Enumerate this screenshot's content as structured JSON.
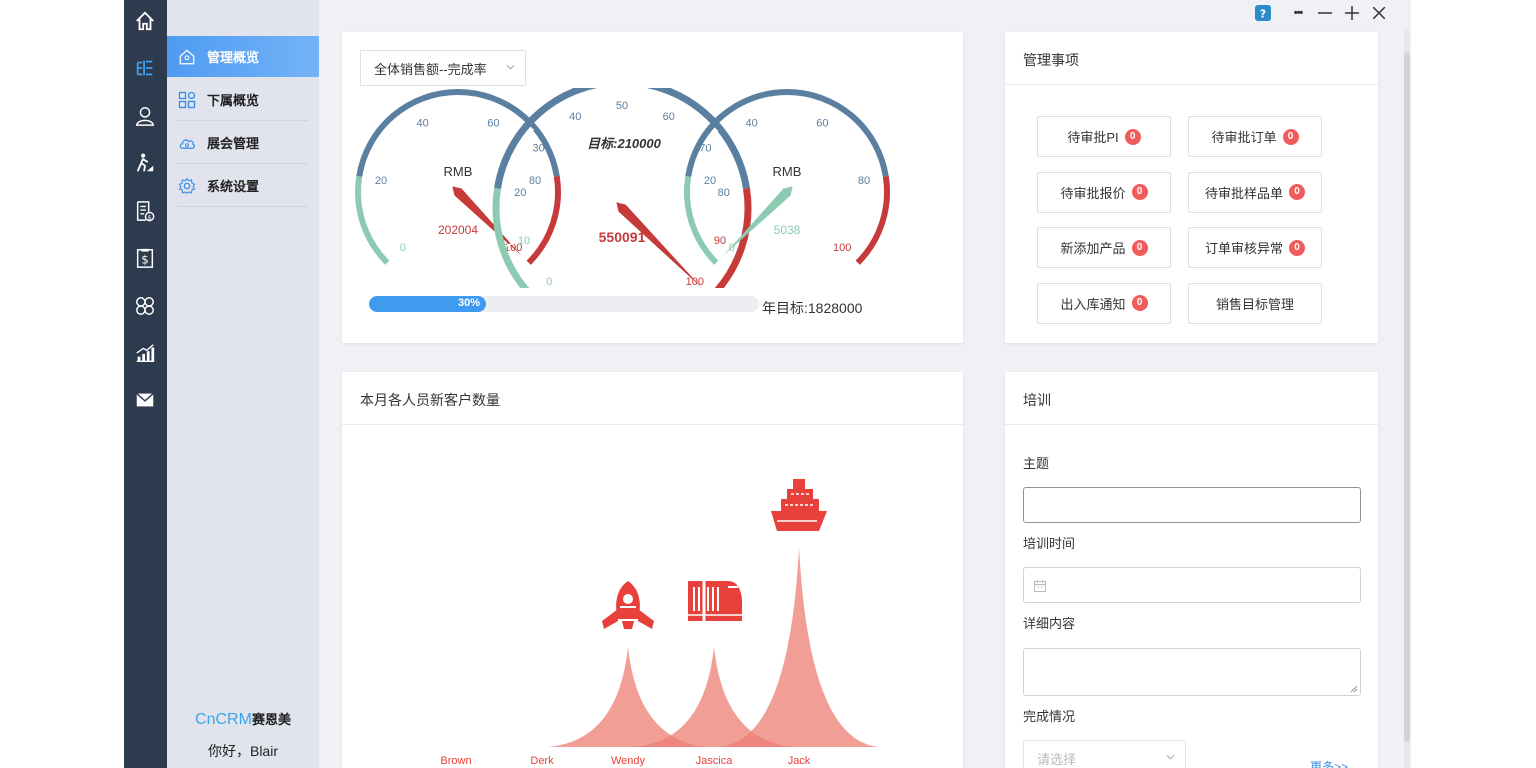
{
  "colors": {
    "rail_bg": "#2e3a4d",
    "nav_bg": "#e1e4ec",
    "nav_active": "#4f9bf2",
    "gauge_blue": "#5a7fa0",
    "gauge_green": "#8ccbb1",
    "gauge_red": "#c63a3a",
    "progress": "#3e9bf0",
    "chart_fill": "#ec7d74",
    "chart_icon": "#e8403a",
    "badge": "#f05c5c"
  },
  "rail": {
    "icons": [
      "home-icon",
      "org-chart-icon",
      "customer-icon",
      "visit-icon",
      "invoice-icon",
      "finance-icon",
      "apps-icon",
      "stats-icon",
      "mail-icon"
    ]
  },
  "nav": {
    "items": [
      {
        "label": "管理概览",
        "icon": "home-outline-icon"
      },
      {
        "label": "下属概览",
        "icon": "grid-icon"
      },
      {
        "label": "展会管理",
        "icon": "cloud-icon"
      },
      {
        "label": "系统设置",
        "icon": "gear-icon"
      }
    ],
    "brand_name": "CnCRM",
    "brand_cn": "赛恩美",
    "greeting": "你好，Blair"
  },
  "window": {
    "help": "?",
    "more": "•••"
  },
  "sales": {
    "select_value": "全体销售额--完成率",
    "gauges": [
      {
        "name": "left",
        "unit": "RMB",
        "value_text": "202004",
        "min": 0,
        "max": 100,
        "pointer": 100,
        "ticks": [
          "0",
          "20",
          "40",
          "60",
          "80",
          "100"
        ]
      },
      {
        "name": "center",
        "title": "目标:210000",
        "value_text": "550091",
        "min": 0,
        "max": 100,
        "pointer": 100,
        "ticks": [
          "0",
          "10",
          "20",
          "30",
          "40",
          "50",
          "60",
          "70",
          "80",
          "90",
          "100"
        ]
      },
      {
        "name": "right",
        "unit": "RMB",
        "value_text": "5038",
        "min": 0,
        "max": 100,
        "pointer": 0,
        "ticks": [
          "0",
          "20",
          "40",
          "60",
          "80",
          "100"
        ]
      }
    ],
    "progress_percent": 30,
    "progress_text": "30%",
    "year_target": "年目标:1828000"
  },
  "manage": {
    "title": "管理事项",
    "buttons": [
      {
        "label": "待审批PI",
        "count": "0"
      },
      {
        "label": "待审批订单",
        "count": "0"
      },
      {
        "label": "待审批报价",
        "count": "0"
      },
      {
        "label": "待审批样品单",
        "count": "0"
      },
      {
        "label": "新添加产品",
        "count": "0"
      },
      {
        "label": "订单审核异常",
        "count": "0"
      },
      {
        "label": "出入库通知",
        "count": "0"
      },
      {
        "label": "销售目标管理",
        "count": null
      }
    ]
  },
  "customers": {
    "title": "本月各人员新客户数量"
  },
  "chart_data": {
    "type": "bar",
    "title": "本月各人员新客户数量",
    "categories": [
      "Brown",
      "Derk",
      "Wendy",
      "Jascica",
      "Jack"
    ],
    "values": [
      0,
      0,
      50,
      50,
      100
    ],
    "ylim": [
      0,
      100
    ],
    "grid": false,
    "pictorial_icons": [
      "",
      "",
      "rocket-icon",
      "train-icon",
      "ship-icon"
    ]
  },
  "training": {
    "title": "培训",
    "subject_label": "主题",
    "subject_value": "",
    "time_label": "培训时间",
    "time_value": "",
    "detail_label": "详细内容",
    "detail_value": "",
    "status_label": "完成情况",
    "status_placeholder": "请选择",
    "more_link": "更多>>"
  }
}
